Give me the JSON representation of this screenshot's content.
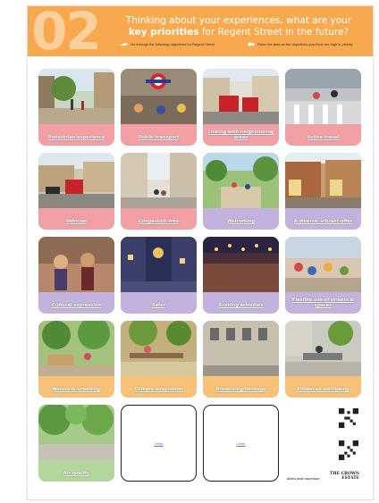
{
  "header": {
    "number": "02",
    "headline_line1": "Thinking about your experiences, what are your",
    "headline_bold": "key priorities",
    "headline_rest": "for Regent Street in the future?",
    "instruction_left": "Go through the following objectives for Regent Street",
    "instruction_right": "Place the dots on the objectives you think are high in priority"
  },
  "cards": [
    {
      "title": "Pedestrian experience",
      "theme": "pink"
    },
    {
      "title": "Public transport",
      "theme": "pink"
    },
    {
      "title": "Linking with neighbouring areas",
      "theme": "pink"
    },
    {
      "title": "Active travel",
      "theme": "pink"
    },
    {
      "title": "Vehicles",
      "theme": "pink"
    },
    {
      "title": "Congestion free",
      "theme": "pink"
    },
    {
      "title": "Welcoming",
      "theme": "purple"
    },
    {
      "title": "A diverse, vibrant offer",
      "theme": "purple"
    },
    {
      "title": "Cultural expression",
      "theme": "purple"
    },
    {
      "title": "Safer",
      "theme": "purple"
    },
    {
      "title": "Evening activities",
      "theme": "purple"
    },
    {
      "title": "Flexible use of streets & spaces",
      "theme": "purple"
    },
    {
      "title": "Nature & Greening",
      "theme": "orange"
    },
    {
      "title": "Climate adaptation",
      "theme": "orange"
    },
    {
      "title": "Preserving heritage",
      "theme": "orange"
    },
    {
      "title": "Enhanced well-being",
      "theme": "orange"
    },
    {
      "title": "Air quality",
      "theme": "green"
    }
  ],
  "blank_cards": [
    {
      "label": "Other"
    },
    {
      "label": "Other"
    }
  ],
  "footer": {
    "brand_left": "allies and morrison",
    "brand_right_line1": "THE CROWN",
    "brand_right_line2": "ESTATE"
  },
  "colors": {
    "banner": "#f8a94d",
    "pink": "#f2a0a6",
    "purple": "#c2b2dd",
    "orange": "#f7c277",
    "green": "#b2d69c"
  }
}
